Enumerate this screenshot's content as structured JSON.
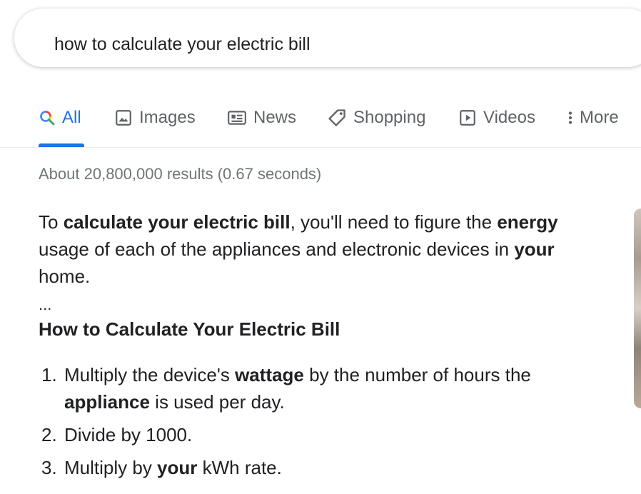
{
  "search": {
    "query": "how to calculate your electric bill"
  },
  "tabs": [
    {
      "label": "All",
      "icon": "search-icon",
      "active": true
    },
    {
      "label": "Images",
      "icon": "image-icon",
      "active": false
    },
    {
      "label": "News",
      "icon": "news-icon",
      "active": false
    },
    {
      "label": "Shopping",
      "icon": "tag-icon",
      "active": false
    },
    {
      "label": "Videos",
      "icon": "video-icon",
      "active": false
    },
    {
      "label": "More",
      "icon": "more-vert-icon",
      "active": false
    }
  ],
  "result_stats": "About 20,800,000 results (0.67 seconds)",
  "snippet": {
    "p1_a": "To ",
    "p1_b": "calculate your electric bill",
    "p1_c": ", you'll need to figure the ",
    "p1_d": "energy",
    "p1_e": " usage of each of the appliances and electronic devices in ",
    "p1_f": "your",
    "p1_g": " home.",
    "ellipsis": "...",
    "heading": "How to Calculate Your Electric Bill",
    "steps": [
      {
        "num": "1.",
        "a": "Multiply the device's ",
        "b": "wattage",
        "c": " by the number of hours the ",
        "d": "appliance",
        "e": " is used per day."
      },
      {
        "num": "2.",
        "a": "Divide by 1000."
      },
      {
        "num": "3.",
        "a": "Multiply by ",
        "b": "your",
        "c": " kWh rate."
      }
    ]
  },
  "colors": {
    "accent": "#1a73e8",
    "muted": "#5f6368",
    "text": "#202124"
  }
}
